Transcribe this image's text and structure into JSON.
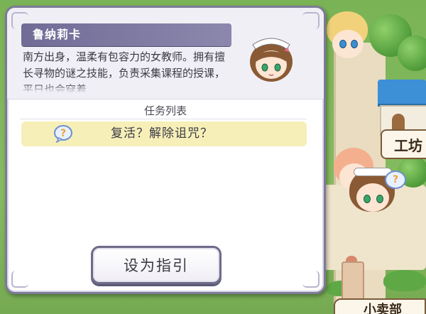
{
  "character": {
    "name": "鲁纳莉卡",
    "description": "南方出身，温柔有包容力的女教师。拥有擅长寻物的谜之技能，负责采集课程的授课，平日也会穿着"
  },
  "task_list": {
    "title": "任务列表",
    "items": [
      {
        "label": "复活？解除诅咒？",
        "icon": "question-bubble-icon"
      }
    ]
  },
  "actions": {
    "set_guide_label": "设为指引"
  },
  "map": {
    "signs": [
      "工坊",
      "小卖部"
    ]
  },
  "colors": {
    "name_bar": "#756f9b",
    "task_highlight": "#f7efb8",
    "panel_border": "#7d7a98",
    "house_roof": "#3d8fd6"
  }
}
